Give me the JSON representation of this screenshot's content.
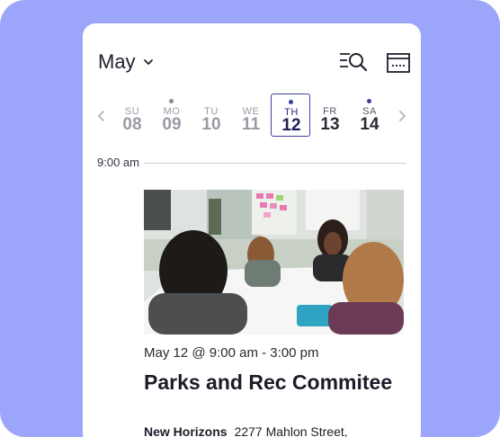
{
  "header": {
    "month": "May",
    "icons": {
      "month_dropdown": "chevron-down-icon",
      "search": "filter-search-icon",
      "calendar": "calendar-icon"
    }
  },
  "week": {
    "days": [
      {
        "dow": "SU",
        "num": "08",
        "has_event": false,
        "state": "past"
      },
      {
        "dow": "MO",
        "num": "09",
        "has_event": true,
        "state": "past"
      },
      {
        "dow": "TU",
        "num": "10",
        "has_event": false,
        "state": "past"
      },
      {
        "dow": "WE",
        "num": "11",
        "has_event": false,
        "state": "past"
      },
      {
        "dow": "TH",
        "num": "12",
        "has_event": true,
        "state": "selected"
      },
      {
        "dow": "FR",
        "num": "13",
        "has_event": false,
        "state": "future"
      },
      {
        "dow": "SA",
        "num": "14",
        "has_event": true,
        "state": "future"
      }
    ]
  },
  "timeline": {
    "time": "9:00 am"
  },
  "event": {
    "when": "May 12 @ 9:00 am - 3:00 pm",
    "title": "Parks and Rec Commitee",
    "venue": "New Horizons",
    "address": "2277 Mahlon Street,"
  },
  "colors": {
    "background": "#9ba6fa",
    "accent": "#3b3f9b",
    "muted": "#9a9aa6",
    "text": "#1c1c28"
  }
}
